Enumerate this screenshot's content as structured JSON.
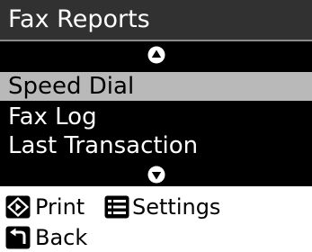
{
  "header": {
    "title": "Fax Reports"
  },
  "menu": {
    "items": [
      {
        "label": "Speed Dial",
        "selected": true
      },
      {
        "label": "Fax Log",
        "selected": false
      },
      {
        "label": "Last Transaction",
        "selected": false
      }
    ],
    "scroll_up_icon": "up-arrow",
    "scroll_down_icon": "down-arrow"
  },
  "footer": {
    "print_label": "Print",
    "print_icon": "start-button-icon",
    "settings_label": "Settings",
    "settings_icon": "menu-list-icon",
    "back_label": "Back",
    "back_icon": "back-arrow-icon"
  },
  "colors": {
    "screen_bg": "#000000",
    "title_bg": "#313131",
    "selected_bg": "#b9b9b9"
  }
}
